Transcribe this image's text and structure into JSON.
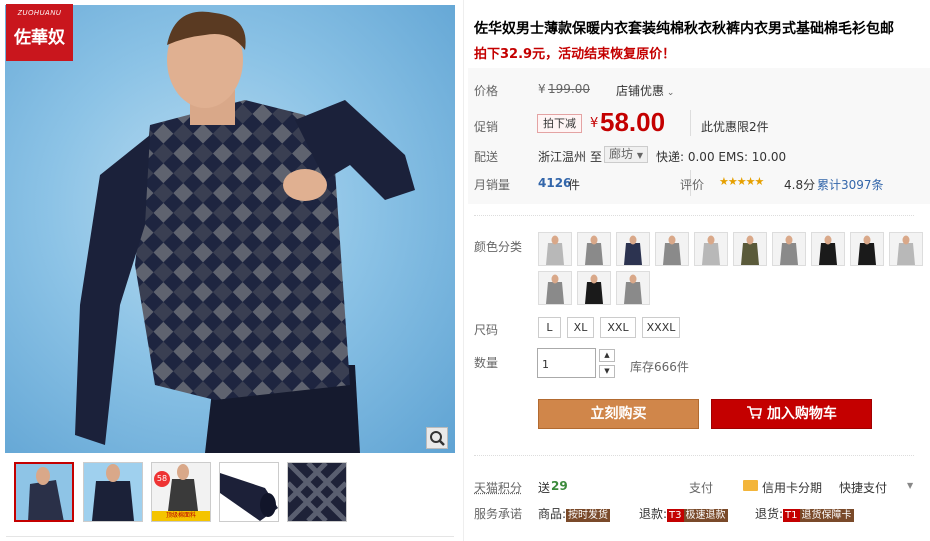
{
  "brand": {
    "logo_en": "ZUOHUANU",
    "logo_cn": "佐華奴"
  },
  "product": {
    "title": "佐华奴男士薄款保暖内衣套装纯棉秋衣秋裤内衣男式基础棉毛衫包邮",
    "promo": "拍下32.9元，活动结束恢复原价！"
  },
  "price": {
    "label": "价格",
    "currency": "¥",
    "original": "199.00",
    "shop_discount": "店铺优惠",
    "promo_label": "促销",
    "promo_tag": "拍下减",
    "sale": "58.00",
    "limit": "此优惠限2件"
  },
  "shipping": {
    "label": "配送",
    "from": "浙江温州",
    "to_word": "至",
    "dest": "廊坊",
    "fees": "快递: 0.00 EMS: 10.00"
  },
  "sales": {
    "label": "月销量",
    "count": "4126",
    "unit": "件",
    "review_label": "评价",
    "stars": "★★★★★",
    "rating": "4.8分",
    "total": "累计3097条"
  },
  "colors": {
    "label": "颜色分类",
    "options": [
      "浅灰",
      "灰色",
      "藏青",
      "灰色",
      "浅灰",
      "军绿",
      "灰色",
      "黑色",
      "黑色",
      "浅灰",
      "灰色",
      "黑色",
      "灰色"
    ]
  },
  "sizes": {
    "label": "尺码",
    "options": [
      "L",
      "XL",
      "XXL",
      "XXXL"
    ]
  },
  "quantity": {
    "label": "数量",
    "value": "1",
    "stock": "库存666件"
  },
  "actions": {
    "buy_now": "立刻购买",
    "add_cart": "加入购物车"
  },
  "points": {
    "label": "天猫积分",
    "send": "送",
    "value": "29",
    "pay_label": "支付",
    "credit": "信用卡分期",
    "quick": "快捷支付"
  },
  "service": {
    "label": "服务承诺",
    "goods": "商品:",
    "goods_chip": "按时发货",
    "refund": "退款:",
    "refund_code": "T3",
    "refund_chip": "极速退款",
    "return": "退货:",
    "return_code": "T1",
    "return_chip": "退货保障卡"
  },
  "thumbs": {
    "badge": "58",
    "strip": "顶级棉面料"
  },
  "colors_theme": {
    "accent": "#c40000",
    "buy": "#d0864a"
  }
}
